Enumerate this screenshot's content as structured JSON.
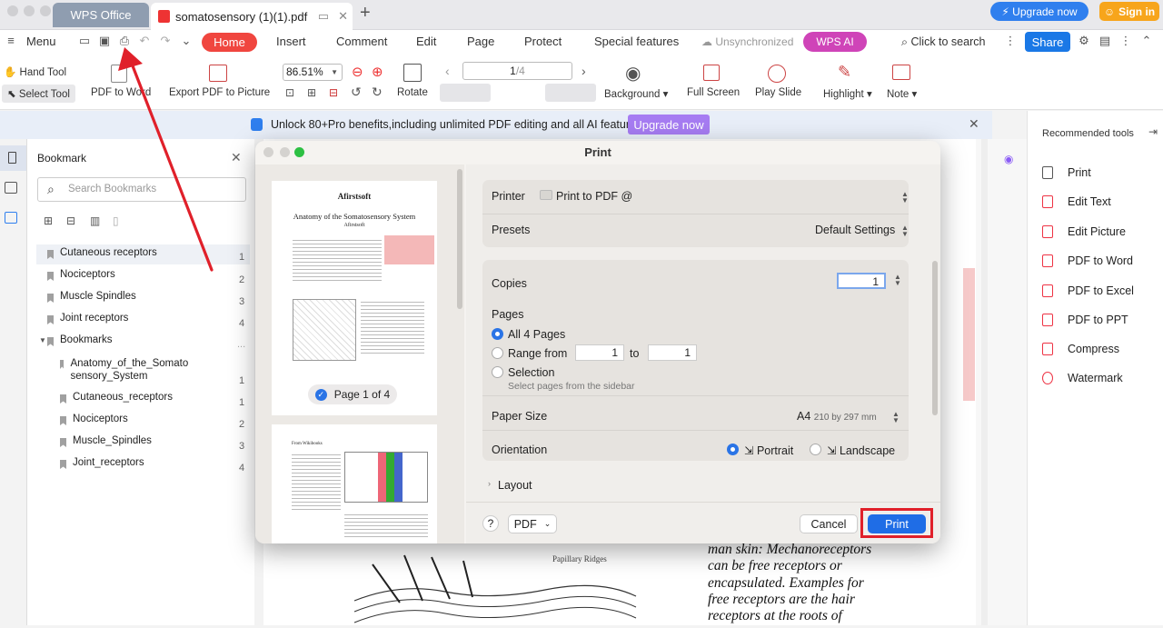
{
  "titlebar": {
    "app_tab": "WPS Office",
    "doc_tab": "somatosensory (1)(1).pdf",
    "upgrade": "⚡ Upgrade now",
    "signin": "Sign in"
  },
  "menubar": {
    "menu": "Menu",
    "tabs": [
      "Home",
      "Insert",
      "Comment",
      "Edit",
      "Page",
      "Protect",
      "Special features"
    ],
    "sync": "Unsynchronized",
    "wps_ai": "WPS AI",
    "search": "Click to search",
    "share": "Share"
  },
  "toolbar": {
    "hand_tool": "Hand Tool",
    "select_tool": "Select Tool",
    "pdf_to_word": "PDF to Word",
    "export_pdf_to_picture": "Export PDF to Picture",
    "zoom": "86.51%",
    "rotate": "Rotate",
    "page_current": "1",
    "page_total": "/4",
    "background": "Background",
    "full_screen": "Full Screen",
    "play_slide": "Play Slide",
    "highlight": "Highlight",
    "note": "Note"
  },
  "banner": {
    "text": "Unlock 80+Pro benefits,including unlimited PDF editing and all AI features.",
    "button": "Upgrade now"
  },
  "bookmark_panel": {
    "title": "Bookmark",
    "search_placeholder": "Search Bookmarks",
    "items": [
      {
        "label": "Cutaneous receptors",
        "page": "1"
      },
      {
        "label": "Nociceptors",
        "page": "2"
      },
      {
        "label": "Muscle Spindles",
        "page": "3"
      },
      {
        "label": "Joint receptors",
        "page": "4"
      },
      {
        "label": "Bookmarks",
        "page": "..."
      },
      {
        "label": "Anatomy_of_the_Somato sensory_System",
        "page": "1"
      },
      {
        "label": "Cutaneous_receptors",
        "page": "1"
      },
      {
        "label": "Nociceptors",
        "page": "2"
      },
      {
        "label": "Muscle_Spindles",
        "page": "3"
      },
      {
        "label": "Joint_receptors",
        "page": "4"
      }
    ]
  },
  "right_panel": {
    "title": "Recommended tools",
    "items": [
      "Print",
      "Edit Text",
      "Edit Picture",
      "PDF to Word",
      "PDF to Excel",
      "PDF to PPT",
      "Compress",
      "Watermark"
    ],
    "colors": [
      "#444",
      "#e34",
      "#e34",
      "#e34",
      "#e34",
      "#e34",
      "#e34",
      "#e34"
    ]
  },
  "document_text": {
    "figure_label": "Papillary Ridges",
    "body": [
      "man skin: Mechanoreceptors",
      "can be free receptors or",
      "encapsulated. Examples for",
      "free receptors are the hair",
      "receptors at the roots of"
    ]
  },
  "print_dialog": {
    "title": "Print",
    "thumb1": {
      "brand": "Afirstsoft",
      "heading": "Anatomy of the Somatosensory System",
      "sub": "Afirstsoft",
      "caption": "Page 1 of 4"
    },
    "thumb2": {
      "label": "From Wikibooks"
    },
    "printer_label": "Printer",
    "printer_value": "Print to PDF @",
    "presets_label": "Presets",
    "presets_value": "Default Settings",
    "copies_label": "Copies",
    "copies_value": "1",
    "pages_label": "Pages",
    "all_pages": "All 4 Pages",
    "range_from": "Range from",
    "range_start": "1",
    "range_to": "to",
    "range_end": "1",
    "selection": "Selection",
    "selection_hint": "Select pages from the sidebar",
    "paper_label": "Paper Size",
    "paper_value": "A4",
    "paper_dims": "210 by 297 mm",
    "orientation_label": "Orientation",
    "portrait": "Portrait",
    "landscape": "Landscape",
    "layout": "Layout",
    "help": "?",
    "pdf_menu": "PDF",
    "cancel": "Cancel",
    "print": "Print"
  },
  "annotation": {
    "arrow_color": "#e0202a",
    "box_color": "#e0202a"
  }
}
